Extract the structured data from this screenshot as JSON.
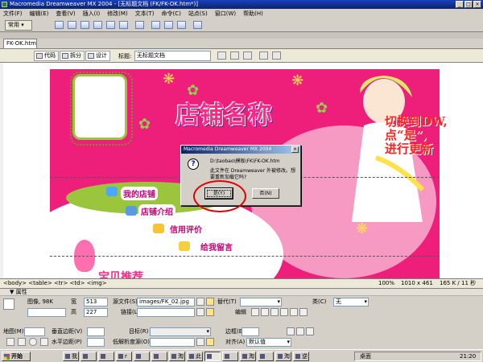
{
  "window": {
    "title": "Macromedia Dreamweaver MX 2004 - [无标题文档 (FK/FK-OK.htm*)]"
  },
  "menu": [
    "文件(F)",
    "编辑(E)",
    "查看(V)",
    "插入(I)",
    "修改(M)",
    "文本(T)",
    "命令(C)",
    "站点(S)",
    "窗口(W)",
    "帮助(H)"
  ],
  "insert_bar": {
    "category": "常用"
  },
  "document": {
    "tab": "FK-OK.htm",
    "view_code": "代码",
    "view_split": "拆分",
    "view_design": "设计",
    "title_label": "标题:",
    "title_value": "无标题文档"
  },
  "design": {
    "shop_name": "店铺名称",
    "nav": [
      "我的店铺",
      "店铺介绍",
      "信用评价",
      "给我留言"
    ],
    "bottom_text": "宝贝推荐"
  },
  "annotation": {
    "line1": "切换到DW,",
    "line2": "点“是”,",
    "line3": "进行更新"
  },
  "dialog": {
    "title": "Macromedia Dreamweaver MX 2004",
    "path": "D:\\taobao\\模板\\FK\\FK-OK.htm",
    "message": "此文件在 Dreamweaver 外被修改。想要重新加载它吗?",
    "yes_label": "是(Y)",
    "no_label": "否(N)"
  },
  "status": {
    "tags": "<body> <table> <tr> <td> <img>",
    "zoom": "100%",
    "size": "1010 x 461",
    "download": "165 K / 11 秒"
  },
  "properties": {
    "header": "▼ 属性",
    "image_label": "图像, 98K",
    "width_label": "宽",
    "width_value": "513",
    "height_label": "高",
    "height_value": "227",
    "src_label": "源文件(S)",
    "src_value": "images/FK_02.jpg",
    "alt_label": "替代(T)",
    "class_label": "类(C)",
    "class_value": "无",
    "link_label": "链接(L)",
    "edit_label": "编辑",
    "map_label": "地图(M)",
    "vspace_label": "垂直边距(V)",
    "target_label": "目标(R)",
    "border_label": "边框(B)",
    "hspace_label": "水平边距(P)",
    "lowsrc_label": "低解析度源(O)",
    "align_label": "对齐(A)",
    "align_value": "默认值"
  },
  "taskbar": {
    "start": "开始",
    "tasks": [
      "我",
      "",
      "",
      "r",
      "",
      "",
      "淘",
      "此",
      "",
      "",
      "淘",
      "",
      "淘",
      "逆"
    ],
    "tray_label": "桌面",
    "clock": "21:20"
  },
  "colors": {
    "accent": "#0a246a",
    "design_bg": "#ee1f7a",
    "annotation": "#ff2020"
  }
}
